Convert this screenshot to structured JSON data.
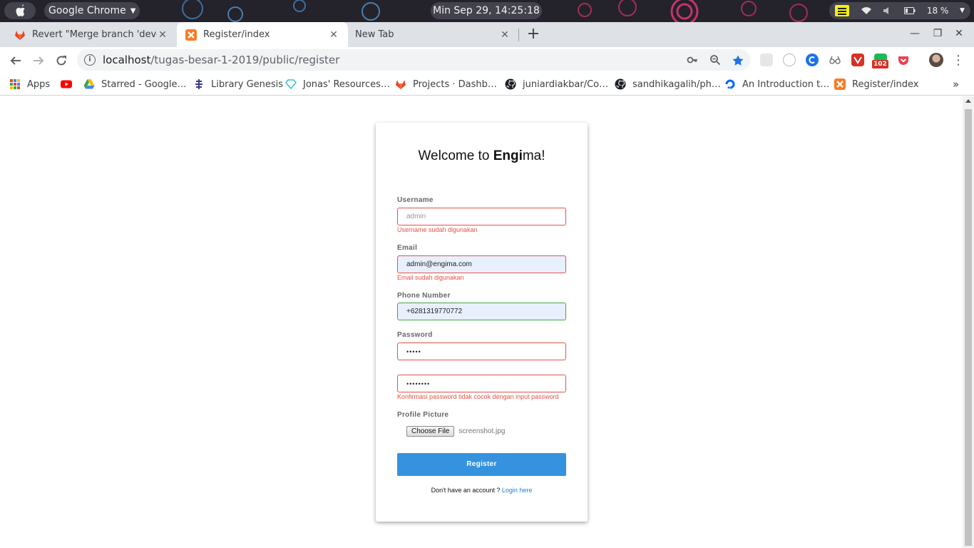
{
  "os": {
    "app_menu": "Google Chrome",
    "clock": "Min Sep 29, 14:25:18",
    "battery": "18 %"
  },
  "tabs": [
    {
      "title": "Revert \"Merge branch 'dev-fix",
      "active": false,
      "icon": "gitlab-icon"
    },
    {
      "title": "Register/index",
      "active": true,
      "icon": "xampp-icon"
    },
    {
      "title": "New Tab",
      "active": false,
      "icon": "none"
    }
  ],
  "toolbar": {
    "url_host": "localhost",
    "url_path": "/tugas-besar-1-2019/public/register",
    "extension_badge": "102"
  },
  "bookmarks": [
    {
      "label": "Apps",
      "icon": "apps-grid-icon"
    },
    {
      "label": "",
      "icon": "youtube-icon"
    },
    {
      "label": "Starred - Google…",
      "icon": "google-drive-icon"
    },
    {
      "label": "Library Genesis",
      "icon": "library-icon"
    },
    {
      "label": "Jonas' Resources…",
      "icon": "diamond-icon"
    },
    {
      "label": "Projects · Dashb…",
      "icon": "gitlab-icon"
    },
    {
      "label": "juniardiakbar/Co…",
      "icon": "github-icon"
    },
    {
      "label": "sandhikagalih/ph…",
      "icon": "github-icon"
    },
    {
      "label": "An Introduction t…",
      "icon": "digitalocean-icon"
    },
    {
      "label": "Register/index",
      "icon": "xampp-icon"
    }
  ],
  "form": {
    "heading_prefix": "Welcome to ",
    "heading_bold": "Engi",
    "heading_suffix": "ma!",
    "username": {
      "label": "Username",
      "placeholder": "admin",
      "error": "Username sudah digunakan"
    },
    "email": {
      "label": "Email",
      "value": "admin@engima.com",
      "error": "Email sudah digunakan"
    },
    "phone": {
      "label": "Phone Number",
      "value": "+6281319770772"
    },
    "password": {
      "label": "Password",
      "value": "•••••"
    },
    "confirm_password": {
      "value": "••••••••",
      "error": "Konfirmasi password tidak cocok dengan input password"
    },
    "profile_picture": {
      "label": "Profile Picture",
      "button": "Choose File",
      "file_name": "screenshot.jpg"
    },
    "submit": "Register",
    "login_prompt": "Don't have an account ? ",
    "login_link": "Login here"
  },
  "colors": {
    "error": "#e2534a",
    "valid": "#3fa64a",
    "primary_button": "#3492de",
    "link": "#1e7fd6"
  }
}
